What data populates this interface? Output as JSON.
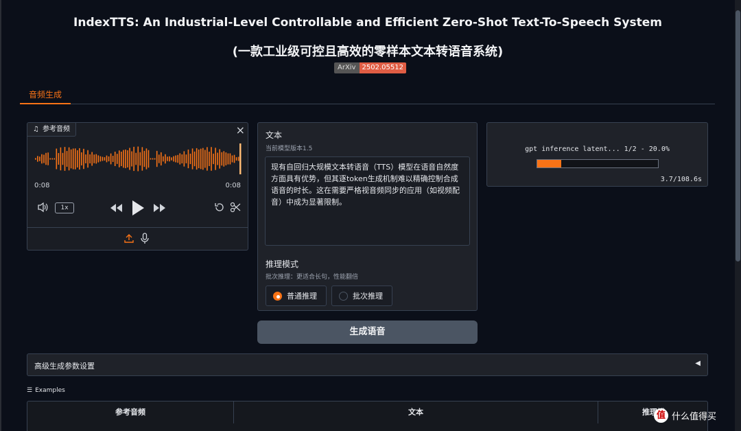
{
  "header": {
    "title": "IndexTTS: An Industrial-Level Controllable and Efficient Zero-Shot Text-To-Speech System",
    "subtitle": "(一款工业级可控且高效的零样本文本转语音系统)",
    "badge_left": "ArXiv",
    "badge_right": "2502.05512"
  },
  "tabs": [
    {
      "label": "音频生成"
    }
  ],
  "audio": {
    "label": "参考音频",
    "time_current": "0:08",
    "time_total": "0:08",
    "speed": "1x"
  },
  "text_panel": {
    "label": "文本",
    "version": "当前模型版本1.5",
    "content": "现有自回归大规模文本转语音（TTS）模型在语音自然度方面具有优势，但其逐token生成机制难以精确控制合成语音的时长。这在需要严格视音频同步的应用（如视频配音）中成为显著限制。",
    "mode_label": "推理模式",
    "mode_hint": "批次推理：更适合长句，性能翻倍",
    "options": [
      "普通推理",
      "批次推理"
    ],
    "selected": "普通推理"
  },
  "generate_button": "生成语音",
  "output": {
    "progress_text": "gpt inference latent... 1/2 - 20.0%",
    "progress": 0.2,
    "elapsed": "3.7/108.6s"
  },
  "advanced": {
    "label": "高级生成参数设置",
    "icon": "triangle-left-icon"
  },
  "examples": {
    "label": "Examples",
    "columns": [
      "参考音频",
      "文本",
      "推理模"
    ]
  },
  "watermark": {
    "text": "什么值得买",
    "logo": "值"
  },
  "colors": {
    "accent": "#f97316",
    "badge_red": "#e05d44"
  }
}
